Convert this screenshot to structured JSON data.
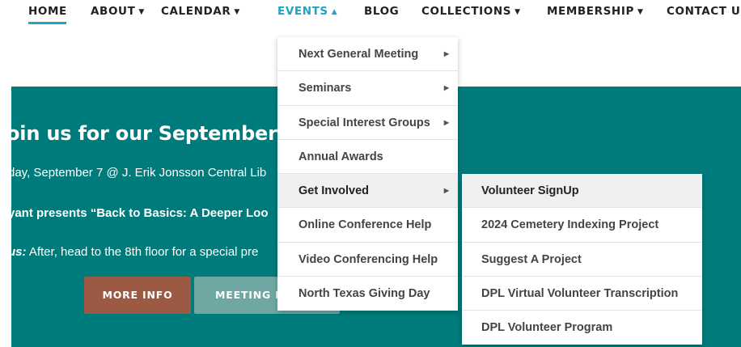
{
  "nav": {
    "items": [
      {
        "label": "HOME",
        "caret": ""
      },
      {
        "label": "ABOUT",
        "caret": "▼"
      },
      {
        "label": "CALENDAR",
        "caret": "▼"
      },
      {
        "label": "EVENTS",
        "caret": "▲"
      },
      {
        "label": "BLOG",
        "caret": ""
      },
      {
        "label": "COLLECTIONS",
        "caret": "▼"
      },
      {
        "label": "MEMBERSHIP",
        "caret": "▼"
      },
      {
        "label": "CONTACT U",
        "caret": ""
      }
    ],
    "active": "HOME",
    "open": "EVENTS",
    "accent_color": "#1fa3c7"
  },
  "hero": {
    "background_color": "#007b7b",
    "title": "oin us for our September G",
    "line1": "day, September 7 @ J. Erik Jonsson Central Lib",
    "line2": "yant presents “Back to Basics: A Deeper Loo",
    "line3_emphasis": "us:",
    "line3_rest": " After, head to the 8th floor for a special pre",
    "more_info_label": "MORE INFO",
    "meeting_label": "MEETING M",
    "more_info_color": "#9c5a45",
    "meeting_color": "#6fa8a3"
  },
  "events_menu": {
    "items": [
      {
        "label": "Next General Meeting",
        "arrow": "▶"
      },
      {
        "label": "Seminars",
        "arrow": "▶"
      },
      {
        "label": "Special Interest Groups",
        "arrow": "▶"
      },
      {
        "label": "Annual Awards",
        "arrow": ""
      },
      {
        "label": "Get Involved",
        "arrow": "▶"
      },
      {
        "label": "Online Conference Help",
        "arrow": ""
      },
      {
        "label": "Video Conferencing Help",
        "arrow": ""
      },
      {
        "label": "North Texas Giving Day",
        "arrow": ""
      }
    ],
    "highlighted": "Get Involved"
  },
  "get_involved_menu": {
    "items": [
      {
        "label": "Volunteer SignUp"
      },
      {
        "label": "2024 Cemetery Indexing Project"
      },
      {
        "label": "Suggest A Project"
      },
      {
        "label": "DPL Virtual Volunteer Transcription"
      },
      {
        "label": "DPL Volunteer Program"
      }
    ],
    "highlighted": "Volunteer SignUp"
  }
}
